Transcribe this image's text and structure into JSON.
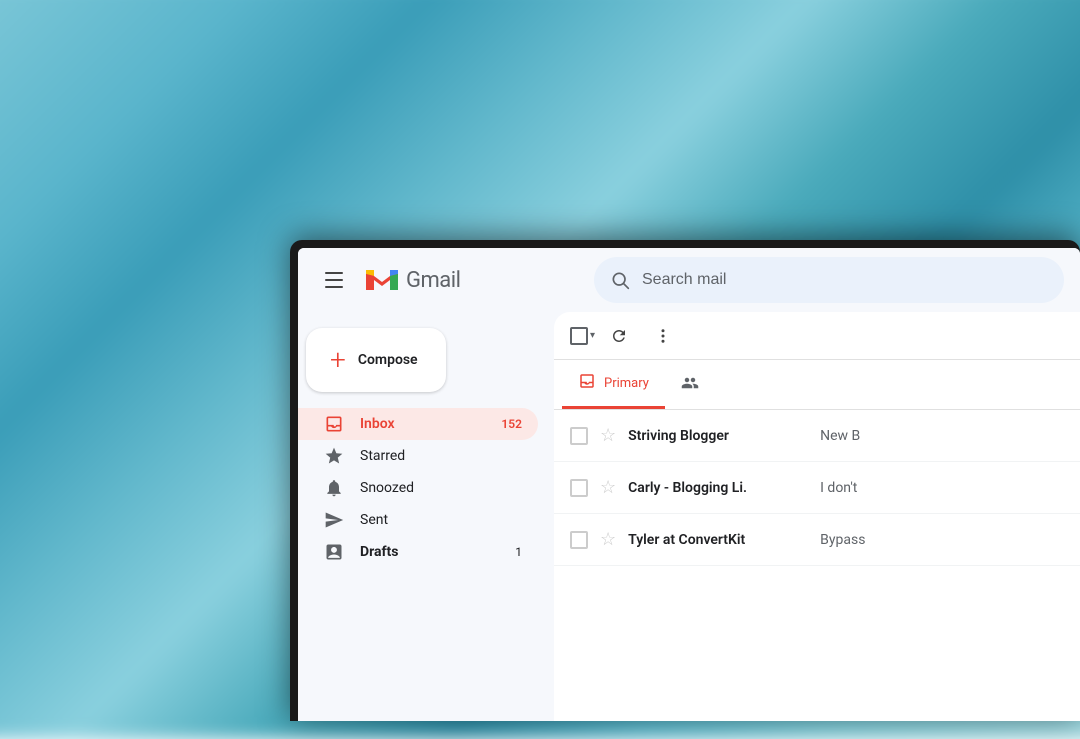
{
  "background": {
    "description": "blurred teal ocean background"
  },
  "header": {
    "menu_label": "menu",
    "logo_text": "Gmail",
    "search_placeholder": "Search mail"
  },
  "sidebar": {
    "compose_label": "Compose",
    "nav_items": [
      {
        "id": "inbox",
        "label": "Inbox",
        "badge": "152",
        "icon": "inbox",
        "active": true
      },
      {
        "id": "starred",
        "label": "Starred",
        "badge": "",
        "icon": "starred",
        "active": false
      },
      {
        "id": "snoozed",
        "label": "Snoozed",
        "badge": "",
        "icon": "snoozed",
        "active": false
      },
      {
        "id": "sent",
        "label": "Sent",
        "badge": "",
        "icon": "sent",
        "active": false
      },
      {
        "id": "drafts",
        "label": "Drafts",
        "badge": "1",
        "icon": "drafts",
        "active": false
      }
    ]
  },
  "toolbar": {
    "select_all_label": "select all",
    "refresh_label": "refresh",
    "more_label": "more options"
  },
  "tabs": [
    {
      "id": "primary",
      "label": "Primary",
      "active": true
    },
    {
      "id": "social",
      "label": "Social",
      "active": false
    }
  ],
  "emails": [
    {
      "sender": "Striving Blogger",
      "preview": "New B",
      "starred": false
    },
    {
      "sender": "Carly - Blogging Li.",
      "preview": "I don't",
      "starred": false
    },
    {
      "sender": "Tyler at ConvertKit",
      "preview": "Bypass",
      "starred": false
    }
  ]
}
